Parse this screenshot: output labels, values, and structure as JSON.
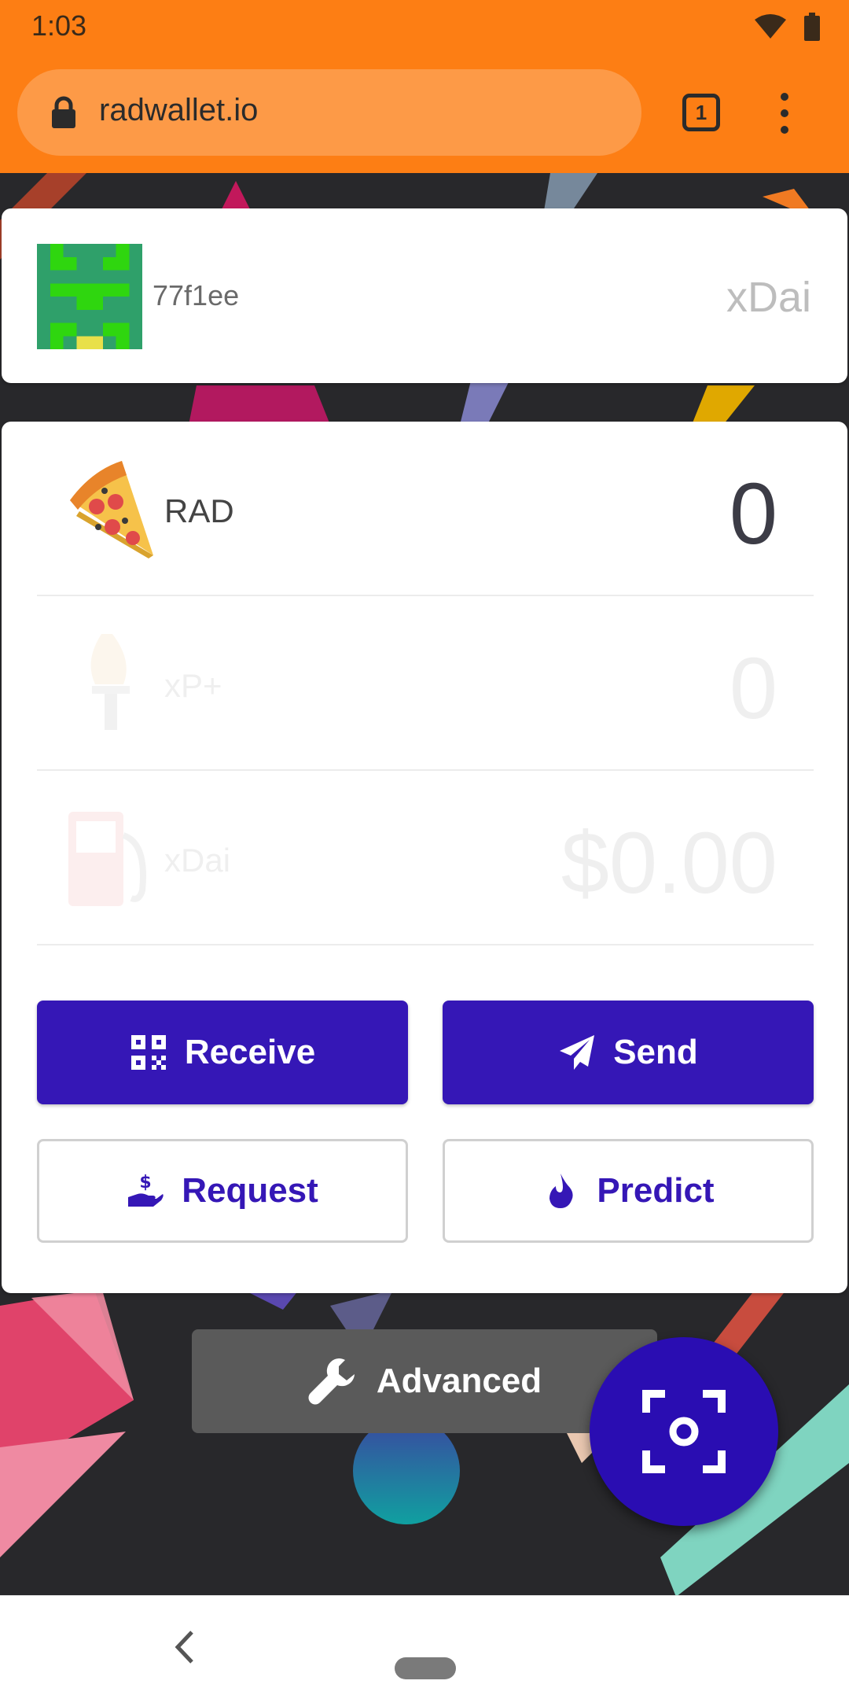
{
  "status_bar": {
    "time": "1:03"
  },
  "browser": {
    "url": "radwallet.io",
    "tab_count": "1"
  },
  "account": {
    "id": "77f1ee",
    "network": "xDai"
  },
  "balances": [
    {
      "label": "RAD",
      "value": "0",
      "icon": "pizza-icon"
    },
    {
      "label": "xP+",
      "value": "0",
      "icon": "torch-icon"
    },
    {
      "label": "xDai",
      "value": "$0.00",
      "icon": "gas-pump-icon"
    }
  ],
  "actions": {
    "receive": "Receive",
    "send": "Send",
    "request": "Request",
    "predict": "Predict",
    "advanced": "Advanced"
  },
  "colors": {
    "chrome": "#fd7e14",
    "primary": "#3517b6",
    "fab": "#2a0db2",
    "background": "#28282b"
  }
}
